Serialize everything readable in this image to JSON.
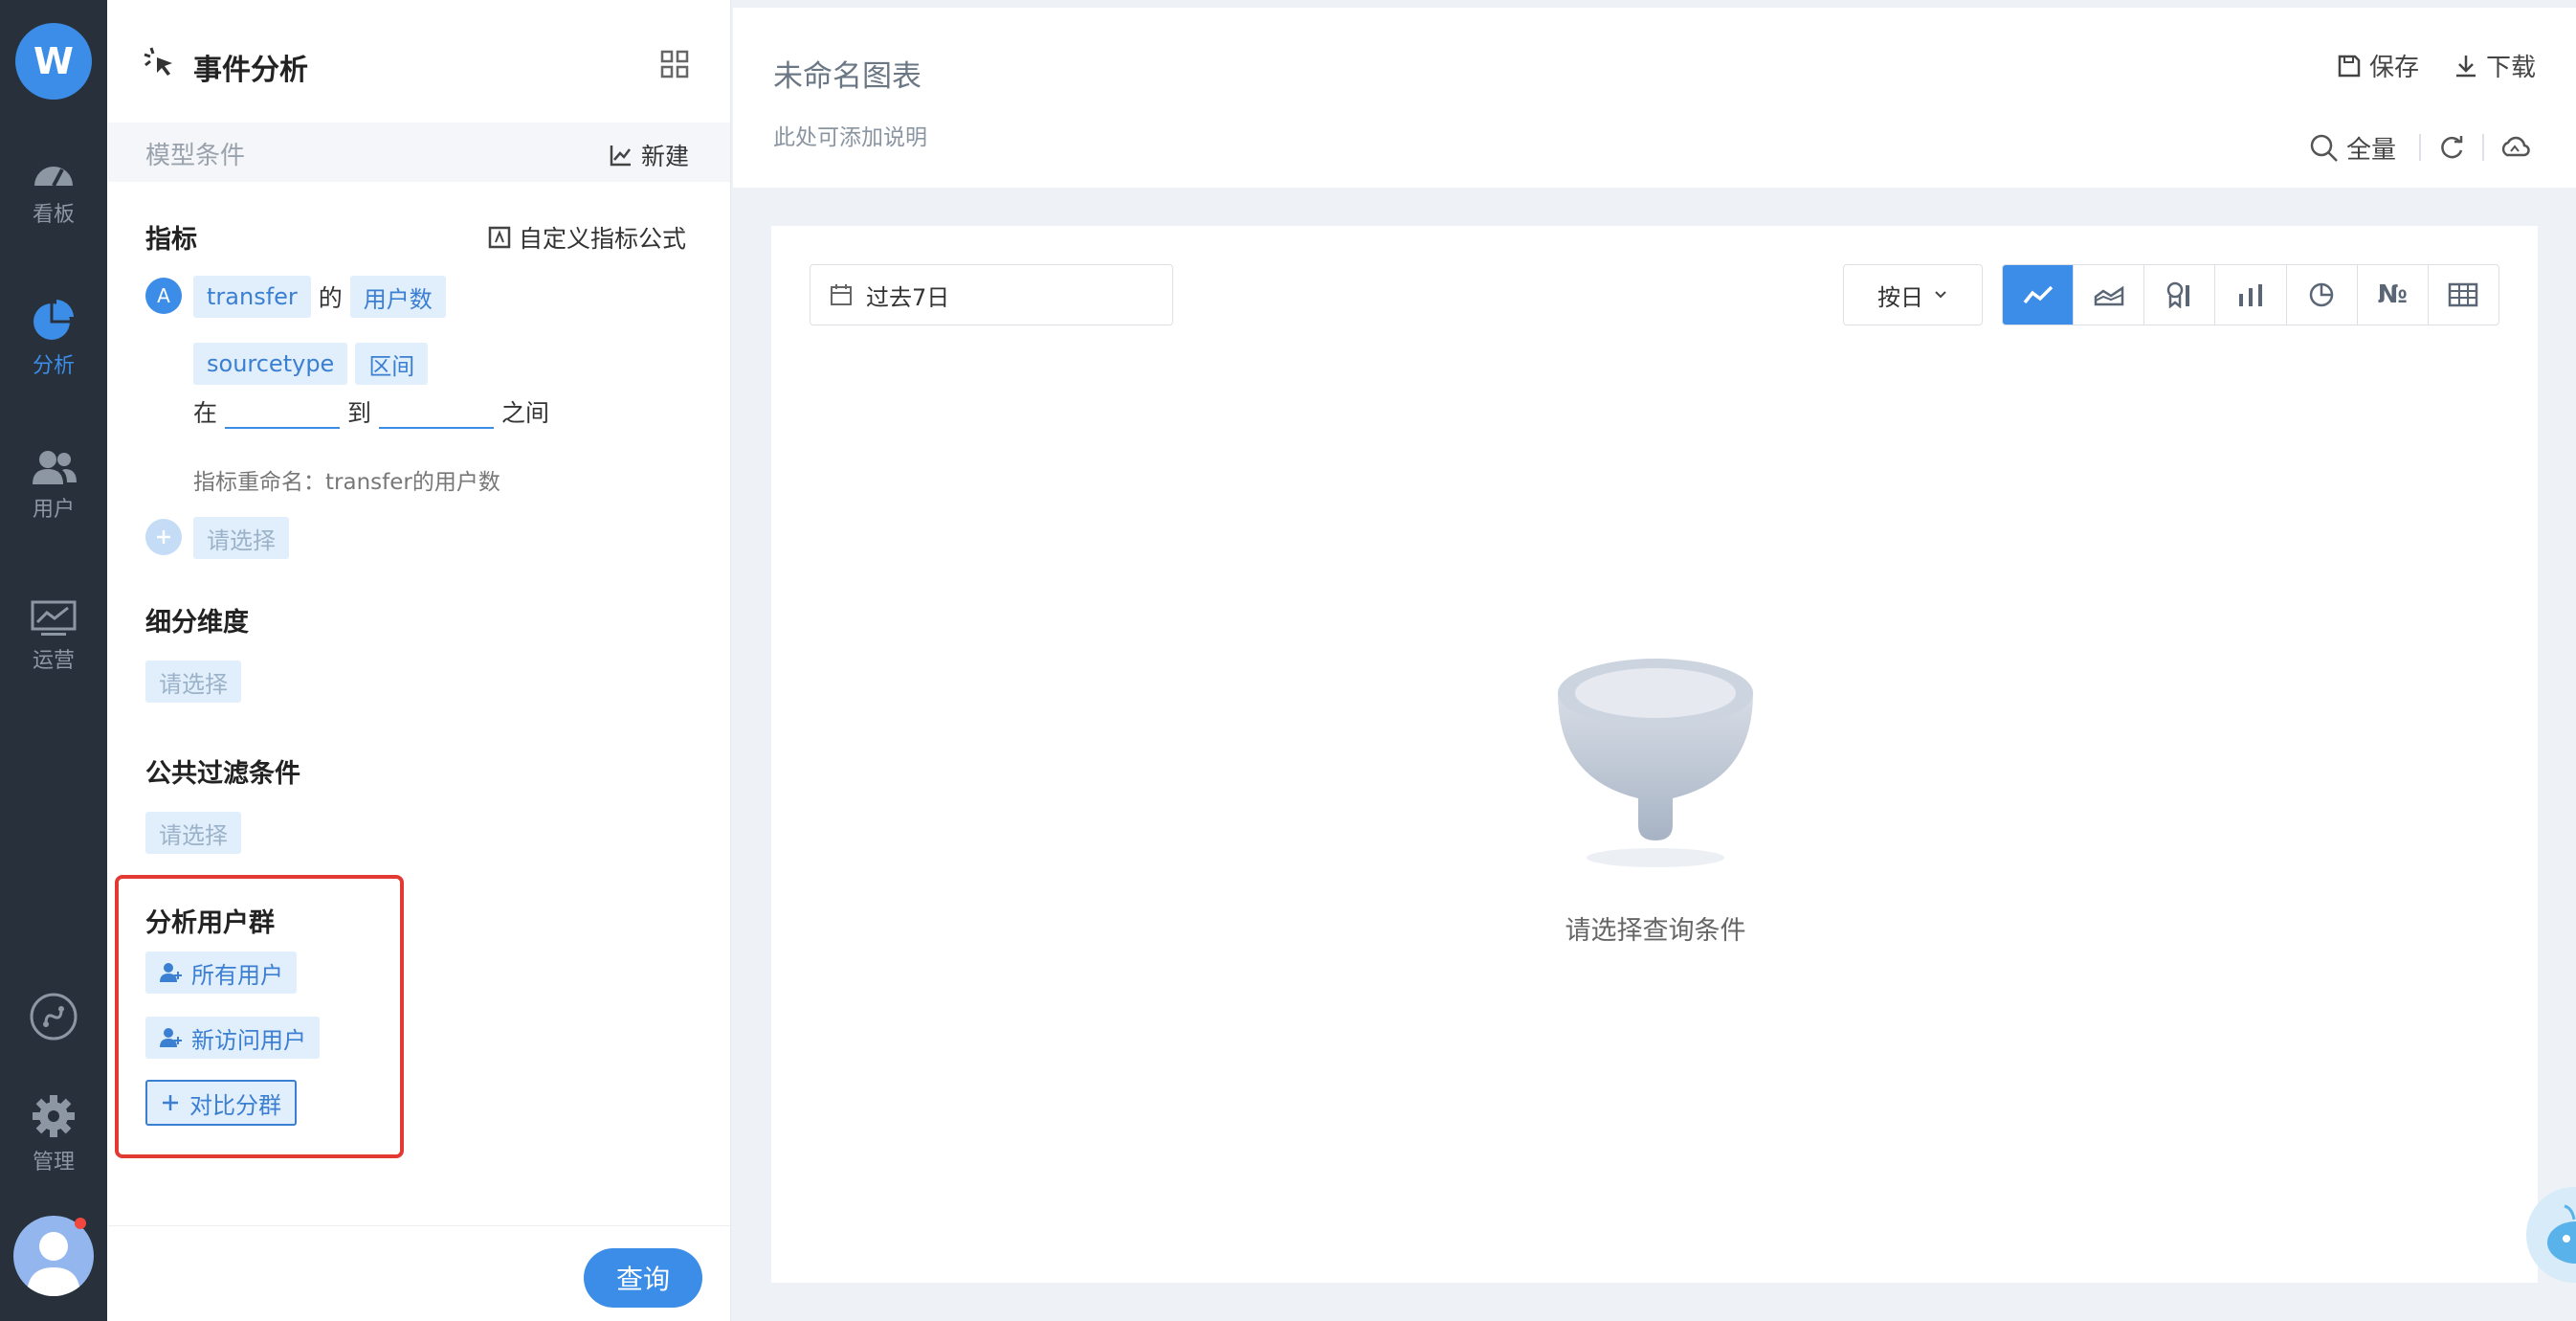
{
  "nav": {
    "logo_letter": "W",
    "items": [
      {
        "label": "看板",
        "icon": "speedometer-icon",
        "active": false
      },
      {
        "label": "分析",
        "icon": "pie-chart-icon",
        "active": true
      },
      {
        "label": "用户",
        "icon": "users-icon",
        "active": false
      },
      {
        "label": "运营",
        "icon": "monitor-chart-icon",
        "active": false
      }
    ],
    "bottom": [
      {
        "label": "",
        "icon": "link-icon"
      },
      {
        "label": "管理",
        "icon": "gear-icon"
      }
    ]
  },
  "panel": {
    "title": "事件分析",
    "title_icon": "cursor-click-icon",
    "grid_icon": "grid-icon",
    "model_label": "模型条件",
    "new_label": "新建",
    "metrics": {
      "title": "指标",
      "custom_formula_label": "自定义指标公式",
      "badge": "A",
      "event": "transfer",
      "of": "的",
      "measure": "用户数",
      "filter_prop": "sourcetype",
      "filter_op": "区间",
      "in": "在",
      "to": "到",
      "between": "之间",
      "rename": "指标重命名：transfer的用户数",
      "add_placeholder": "请选择"
    },
    "breakdown": {
      "title": "细分维度",
      "placeholder": "请选择"
    },
    "filter": {
      "title": "公共过滤条件",
      "placeholder": "请选择"
    },
    "groups": {
      "title": "分析用户群",
      "items": [
        "所有用户",
        "新访问用户"
      ],
      "compare_label": "对比分群"
    },
    "query_label": "查询"
  },
  "main": {
    "chart_title": "未命名图表",
    "description_placeholder": "此处可添加说明",
    "save_label": "保存",
    "download_label": "下载",
    "sampling_label": "全量",
    "date_range": "过去7日",
    "granularity": "按日",
    "chart_types": [
      "line",
      "area",
      "funnel-rank",
      "bar",
      "pie",
      "number",
      "table"
    ],
    "number_glyph": "№",
    "empty_text": "请选择查询条件"
  },
  "colors": {
    "accent": "#3b8de8",
    "nav_bg": "#28313b",
    "highlight": "#e23a32"
  }
}
